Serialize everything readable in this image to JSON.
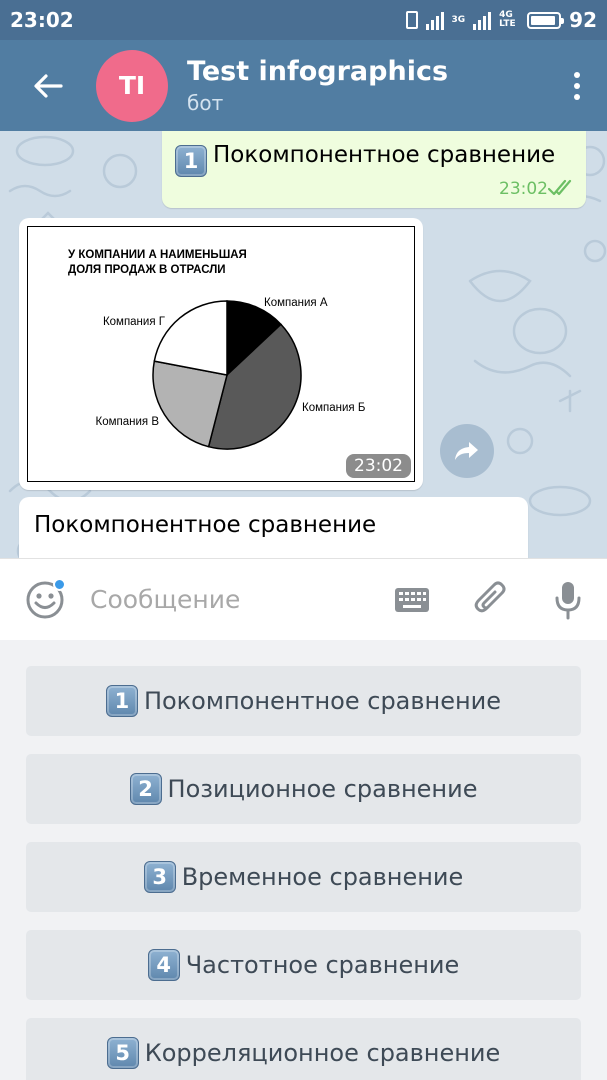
{
  "status_bar": {
    "time": "23:02",
    "network_label": "3G",
    "network_label_2": "4G LTE",
    "battery": "92",
    "battery_level": 0.92
  },
  "header": {
    "avatar_initials": "TI",
    "avatar_color": "#f06b8b",
    "title": "Test infographics",
    "subtitle": "бот"
  },
  "messages": {
    "outgoing": {
      "keycap": "1",
      "text": "Покомпонентное сравнение",
      "time": "23:02"
    },
    "photo": {
      "time": "23:02"
    },
    "incoming": {
      "text": "Покомпонентное сравнение"
    }
  },
  "chart_data": {
    "type": "pie",
    "title_line1": "У КОМПАНИИ А НАИМЕНЬШАЯ",
    "title_line2": "ДОЛЯ ПРОДАЖ В ОТРАСЛИ",
    "slices": [
      {
        "label": "Компания А",
        "value": 13,
        "color": "#000000"
      },
      {
        "label": "Компания Б",
        "value": 41,
        "color": "#595959"
      },
      {
        "label": "Компания В",
        "value": 24,
        "color": "#b3b3b3"
      },
      {
        "label": "Компания Г",
        "value": 22,
        "color": "#ffffff"
      }
    ]
  },
  "input": {
    "placeholder": "Сообщение"
  },
  "keyboard": {
    "buttons": [
      {
        "num": "1",
        "label": "Покомпонентное сравнение"
      },
      {
        "num": "2",
        "label": "Позиционное сравнение"
      },
      {
        "num": "3",
        "label": "Временное сравнение"
      },
      {
        "num": "4",
        "label": "Частотное сравнение"
      },
      {
        "num": "5",
        "label": "Корреляционное сравнение"
      }
    ]
  },
  "colors": {
    "header_bg": "#517da2",
    "status_bg": "#4a6f93",
    "outgoing_bubble": "#effdde",
    "chat_bg": "#d0dde8",
    "keyboard_button": "#e4e7ea"
  }
}
